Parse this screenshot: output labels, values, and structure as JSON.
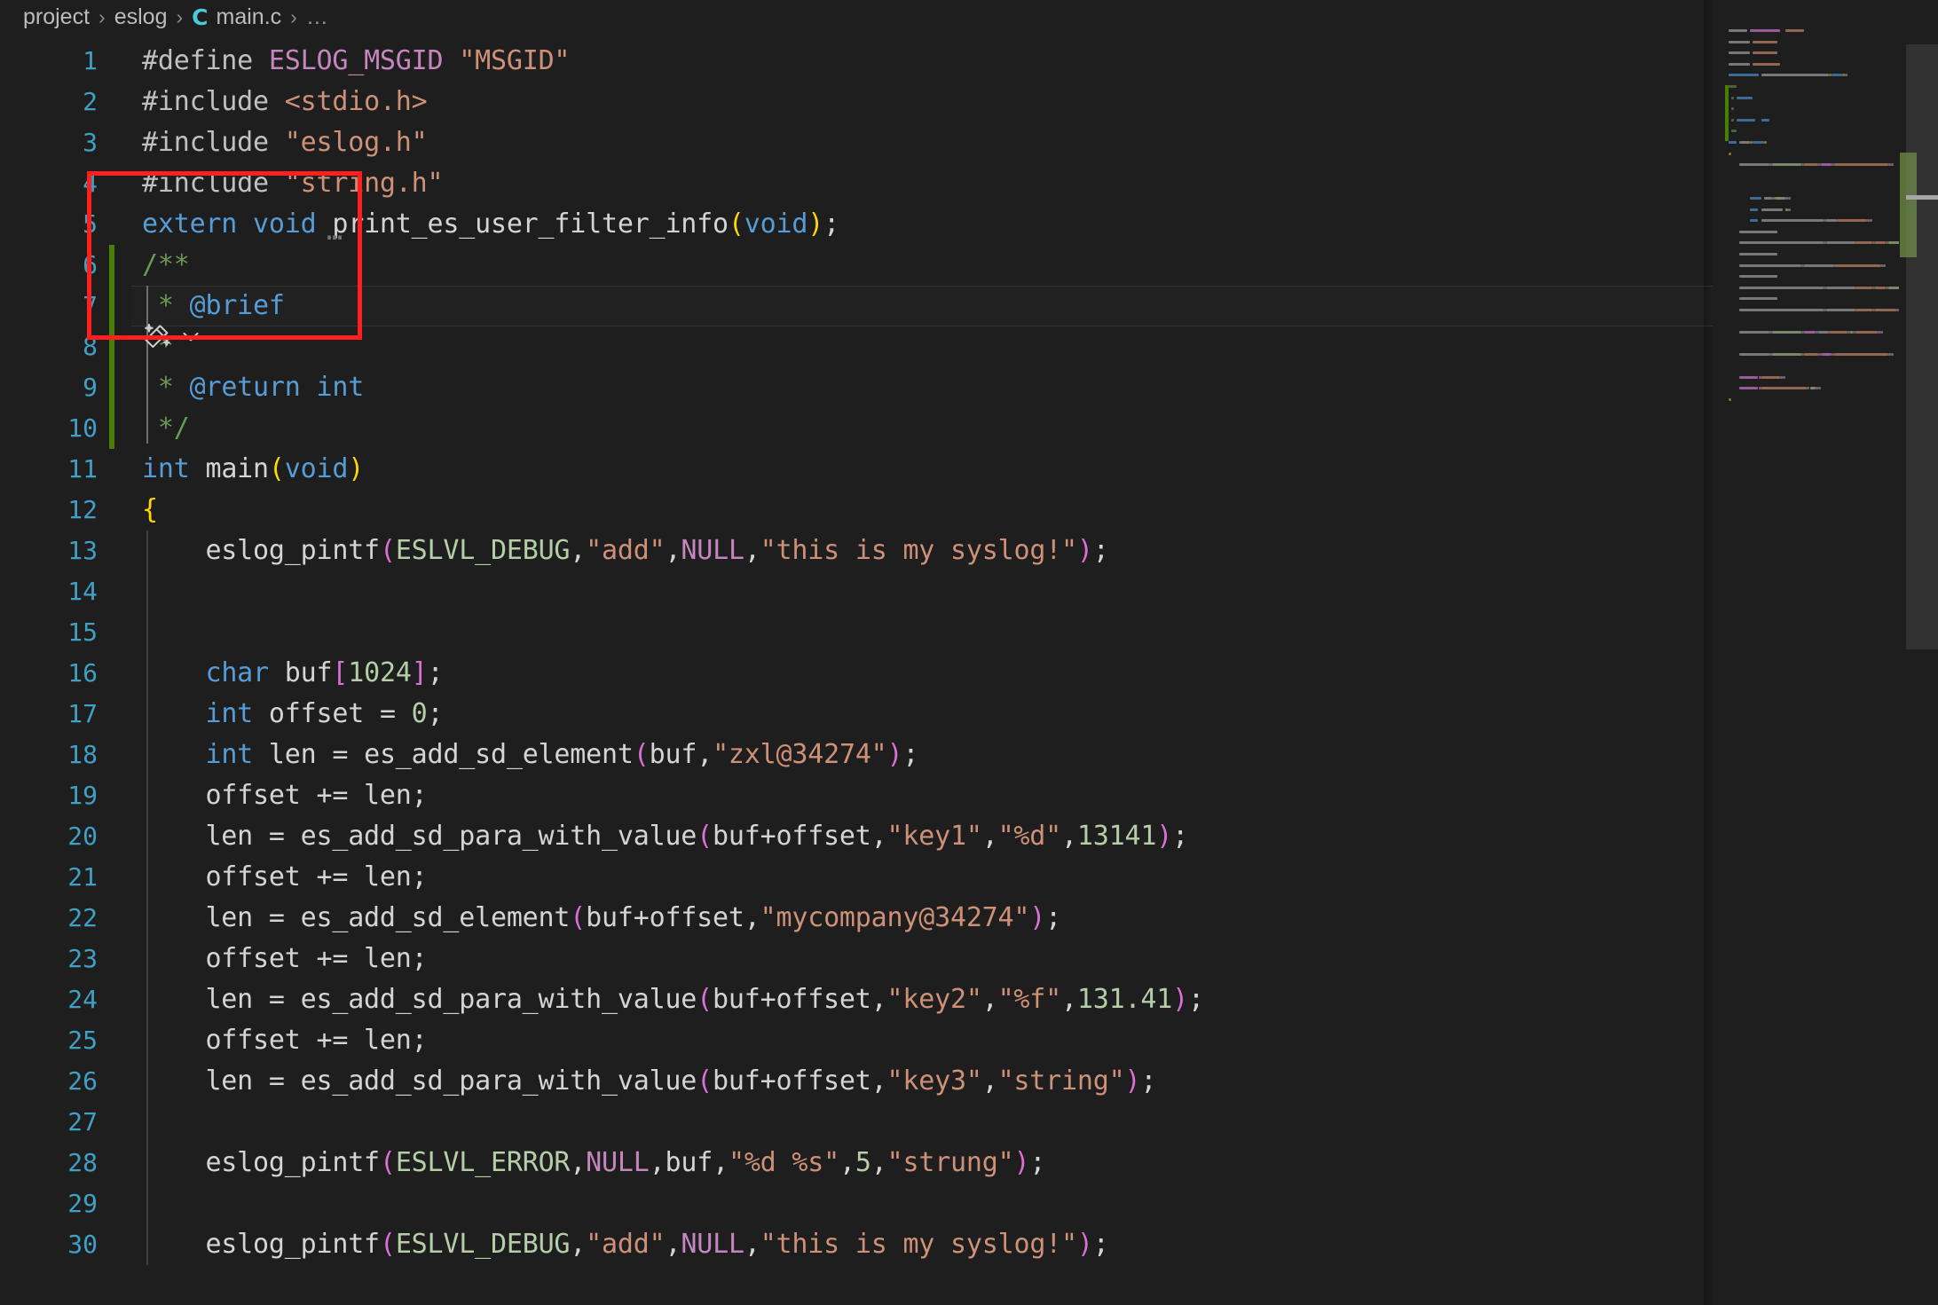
{
  "window": {
    "background": "#1e1e1e",
    "accent_red": "#ff1f1f",
    "gutter_modified_green": "#487e02",
    "line_number_color": "#3f9fc4"
  },
  "breadcrumb": {
    "items": [
      "project",
      "eslog",
      "main.c"
    ],
    "file_icon_label": "C",
    "separator": "›",
    "overflow": "…"
  },
  "editor": {
    "language": "c",
    "cursor_line": 7,
    "first_visible_line": 1,
    "last_visible_line": 30,
    "ghost_suggestion_marker": "…",
    "lines": [
      {
        "n": "1",
        "tokens": [
          {
            "t": "#define ",
            "c": "pp"
          },
          {
            "t": "ESLOG_MSGID",
            "c": "macro"
          },
          {
            "t": " ",
            "c": "plain"
          },
          {
            "t": "\"MSGID\"",
            "c": "str"
          }
        ]
      },
      {
        "n": "2",
        "tokens": [
          {
            "t": "#include ",
            "c": "pp"
          },
          {
            "t": "<stdio.h>",
            "c": "str"
          }
        ]
      },
      {
        "n": "3",
        "tokens": [
          {
            "t": "#include ",
            "c": "pp"
          },
          {
            "t": "\"eslog.h\"",
            "c": "str"
          }
        ]
      },
      {
        "n": "4",
        "tokens": [
          {
            "t": "#include ",
            "c": "pp"
          },
          {
            "t": "\"string.h\"",
            "c": "str"
          }
        ]
      },
      {
        "n": "5",
        "tokens": [
          {
            "t": "extern void",
            "c": "kw"
          },
          {
            "t": " print_es_user_filter_info",
            "c": "ident"
          },
          {
            "t": "(",
            "c": "par1"
          },
          {
            "t": "void",
            "c": "kw"
          },
          {
            "t": ")",
            "c": "par1"
          },
          {
            "t": ";",
            "c": "plain"
          }
        ]
      },
      {
        "n": "6",
        "tokens": [
          {
            "t": "/**",
            "c": "cmt"
          }
        ]
      },
      {
        "n": "7",
        "tokens": [
          {
            "t": " * ",
            "c": "cmt"
          },
          {
            "t": "@brief",
            "c": "tag"
          }
        ]
      },
      {
        "n": "8",
        "tokens": [
          {
            "t": " *",
            "c": "cmt"
          }
        ]
      },
      {
        "n": "9",
        "tokens": [
          {
            "t": " * ",
            "c": "cmt"
          },
          {
            "t": "@return",
            "c": "tag"
          },
          {
            "t": " ",
            "c": "cmt"
          },
          {
            "t": "int",
            "c": "tag"
          }
        ]
      },
      {
        "n": "10",
        "tokens": [
          {
            "t": " */",
            "c": "cmt"
          }
        ]
      },
      {
        "n": "11",
        "tokens": [
          {
            "t": "int",
            "c": "kw"
          },
          {
            "t": " main",
            "c": "ident"
          },
          {
            "t": "(",
            "c": "par1"
          },
          {
            "t": "void",
            "c": "kw"
          },
          {
            "t": ")",
            "c": "par1"
          }
        ]
      },
      {
        "n": "12",
        "tokens": [
          {
            "t": "{",
            "c": "par1"
          }
        ]
      },
      {
        "n": "13",
        "tokens": [
          {
            "t": "    eslog_pintf",
            "c": "ident"
          },
          {
            "t": "(",
            "c": "par2"
          },
          {
            "t": "ESLVL_DEBUG",
            "c": "const"
          },
          {
            "t": ",",
            "c": "plain"
          },
          {
            "t": "\"add\"",
            "c": "str"
          },
          {
            "t": ",",
            "c": "plain"
          },
          {
            "t": "NULL",
            "c": "macro"
          },
          {
            "t": ",",
            "c": "plain"
          },
          {
            "t": "\"this is my syslog!\"",
            "c": "str"
          },
          {
            "t": ")",
            "c": "par2"
          },
          {
            "t": ";",
            "c": "plain"
          }
        ]
      },
      {
        "n": "14",
        "tokens": []
      },
      {
        "n": "15",
        "tokens": []
      },
      {
        "n": "16",
        "tokens": [
          {
            "t": "    ",
            "c": "plain"
          },
          {
            "t": "char",
            "c": "kw"
          },
          {
            "t": " buf",
            "c": "ident"
          },
          {
            "t": "[",
            "c": "par2"
          },
          {
            "t": "1024",
            "c": "num"
          },
          {
            "t": "]",
            "c": "par2"
          },
          {
            "t": ";",
            "c": "plain"
          }
        ]
      },
      {
        "n": "17",
        "tokens": [
          {
            "t": "    ",
            "c": "plain"
          },
          {
            "t": "int",
            "c": "kw"
          },
          {
            "t": " offset = ",
            "c": "ident"
          },
          {
            "t": "0",
            "c": "num"
          },
          {
            "t": ";",
            "c": "plain"
          }
        ]
      },
      {
        "n": "18",
        "tokens": [
          {
            "t": "    ",
            "c": "plain"
          },
          {
            "t": "int",
            "c": "kw"
          },
          {
            "t": " len = es_add_sd_element",
            "c": "ident"
          },
          {
            "t": "(",
            "c": "par2"
          },
          {
            "t": "buf,",
            "c": "ident"
          },
          {
            "t": "\"zxl@34274\"",
            "c": "str"
          },
          {
            "t": ")",
            "c": "par2"
          },
          {
            "t": ";",
            "c": "plain"
          }
        ]
      },
      {
        "n": "19",
        "tokens": [
          {
            "t": "    offset += len;",
            "c": "ident"
          }
        ]
      },
      {
        "n": "20",
        "tokens": [
          {
            "t": "    len = es_add_sd_para_with_value",
            "c": "ident"
          },
          {
            "t": "(",
            "c": "par2"
          },
          {
            "t": "buf+offset,",
            "c": "ident"
          },
          {
            "t": "\"key1\"",
            "c": "str"
          },
          {
            "t": ",",
            "c": "plain"
          },
          {
            "t": "\"%d\"",
            "c": "str"
          },
          {
            "t": ",",
            "c": "plain"
          },
          {
            "t": "13141",
            "c": "num"
          },
          {
            "t": ")",
            "c": "par2"
          },
          {
            "t": ";",
            "c": "plain"
          }
        ]
      },
      {
        "n": "21",
        "tokens": [
          {
            "t": "    offset += len;",
            "c": "ident"
          }
        ]
      },
      {
        "n": "22",
        "tokens": [
          {
            "t": "    len = es_add_sd_element",
            "c": "ident"
          },
          {
            "t": "(",
            "c": "par2"
          },
          {
            "t": "buf+offset,",
            "c": "ident"
          },
          {
            "t": "\"mycompany@34274\"",
            "c": "str"
          },
          {
            "t": ")",
            "c": "par2"
          },
          {
            "t": ";",
            "c": "plain"
          }
        ]
      },
      {
        "n": "23",
        "tokens": [
          {
            "t": "    offset += len;",
            "c": "ident"
          }
        ]
      },
      {
        "n": "24",
        "tokens": [
          {
            "t": "    len = es_add_sd_para_with_value",
            "c": "ident"
          },
          {
            "t": "(",
            "c": "par2"
          },
          {
            "t": "buf+offset,",
            "c": "ident"
          },
          {
            "t": "\"key2\"",
            "c": "str"
          },
          {
            "t": ",",
            "c": "plain"
          },
          {
            "t": "\"%f\"",
            "c": "str"
          },
          {
            "t": ",",
            "c": "plain"
          },
          {
            "t": "131.41",
            "c": "num"
          },
          {
            "t": ")",
            "c": "par2"
          },
          {
            "t": ";",
            "c": "plain"
          }
        ]
      },
      {
        "n": "25",
        "tokens": [
          {
            "t": "    offset += len;",
            "c": "ident"
          }
        ]
      },
      {
        "n": "26",
        "tokens": [
          {
            "t": "    len = es_add_sd_para_with_value",
            "c": "ident"
          },
          {
            "t": "(",
            "c": "par2"
          },
          {
            "t": "buf+offset,",
            "c": "ident"
          },
          {
            "t": "\"key3\"",
            "c": "str"
          },
          {
            "t": ",",
            "c": "plain"
          },
          {
            "t": "\"string\"",
            "c": "str"
          },
          {
            "t": ")",
            "c": "par2"
          },
          {
            "t": ";",
            "c": "plain"
          }
        ]
      },
      {
        "n": "27",
        "tokens": []
      },
      {
        "n": "28",
        "tokens": [
          {
            "t": "    eslog_pintf",
            "c": "ident"
          },
          {
            "t": "(",
            "c": "par2"
          },
          {
            "t": "ESLVL_ERROR",
            "c": "const"
          },
          {
            "t": ",",
            "c": "plain"
          },
          {
            "t": "NULL",
            "c": "macro"
          },
          {
            "t": ",",
            "c": "plain"
          },
          {
            "t": "buf,",
            "c": "ident"
          },
          {
            "t": "\"%d %s\"",
            "c": "str"
          },
          {
            "t": ",",
            "c": "plain"
          },
          {
            "t": "5",
            "c": "num"
          },
          {
            "t": ",",
            "c": "plain"
          },
          {
            "t": "\"strung\"",
            "c": "str"
          },
          {
            "t": ")",
            "c": "par2"
          },
          {
            "t": ";",
            "c": "plain"
          }
        ]
      },
      {
        "n": "29",
        "tokens": []
      },
      {
        "n": "30",
        "tokens": [
          {
            "t": "    eslog_pintf",
            "c": "ident"
          },
          {
            "t": "(",
            "c": "par2"
          },
          {
            "t": "ESLVL_DEBUG",
            "c": "const"
          },
          {
            "t": ",",
            "c": "plain"
          },
          {
            "t": "\"add\"",
            "c": "str"
          },
          {
            "t": ",",
            "c": "plain"
          },
          {
            "t": "NULL",
            "c": "macro"
          },
          {
            "t": ",",
            "c": "plain"
          },
          {
            "t": "\"this is my syslog!\"",
            "c": "str"
          },
          {
            "t": ")",
            "c": "par2"
          },
          {
            "t": ";",
            "c": "plain"
          }
        ]
      }
    ]
  },
  "copilot_widget": {
    "icon": "sparkle-wand-icon",
    "chevron": "chevron-down-icon"
  },
  "minimap": {
    "visible": true,
    "slider_visible": true
  }
}
